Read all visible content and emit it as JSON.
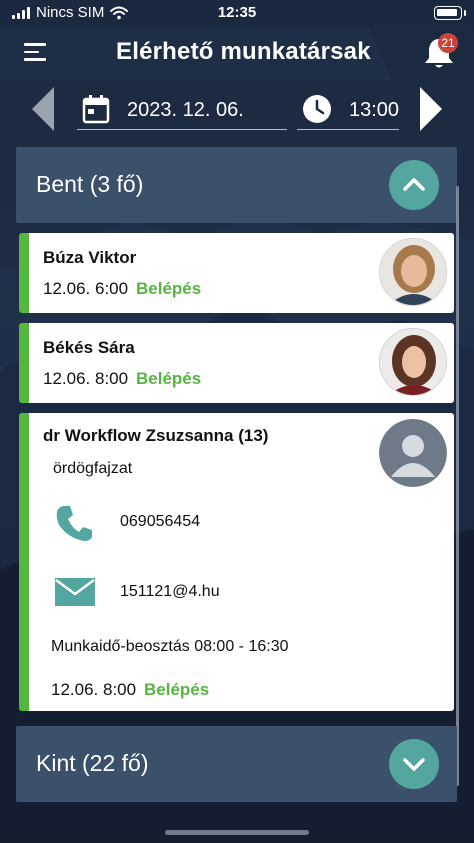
{
  "status_bar": {
    "carrier": "Nincs SIM",
    "time": "12:35"
  },
  "header": {
    "title": "Elérhető munkatársak",
    "notification_count": "21",
    "menu_icon": "hamburger-menu-icon",
    "bell_icon": "bell-icon"
  },
  "filter": {
    "date": "2023. 12. 06.",
    "time": "13:00",
    "prev_icon": "chevron-left-icon",
    "next_icon": "chevron-right-icon"
  },
  "sections": {
    "inside": {
      "title": "Bent (3 fő)",
      "expanded": true
    },
    "outside": {
      "title": "Kint (22 fő)",
      "expanded": false
    }
  },
  "employees": [
    {
      "name": "Búza Viktor",
      "timestamp": "12.06. 6:00",
      "status": "Belépés"
    },
    {
      "name": "Békés Sára",
      "timestamp": "12.06. 8:00",
      "status": "Belépés"
    },
    {
      "name": "dr Workflow Zsuzsanna (13)",
      "position": "ördögfajzat",
      "phone": "069056454",
      "email": "151121@4.hu",
      "schedule": "Munkaidő-beosztás 08:00 - 16:30",
      "timestamp": "12.06. 8:00",
      "status": "Belépés"
    }
  ],
  "colors": {
    "accent_teal": "#54a6a0",
    "status_green": "#54b83f",
    "section_bg": "#3b506b",
    "header_bg": "#1e2e47"
  }
}
